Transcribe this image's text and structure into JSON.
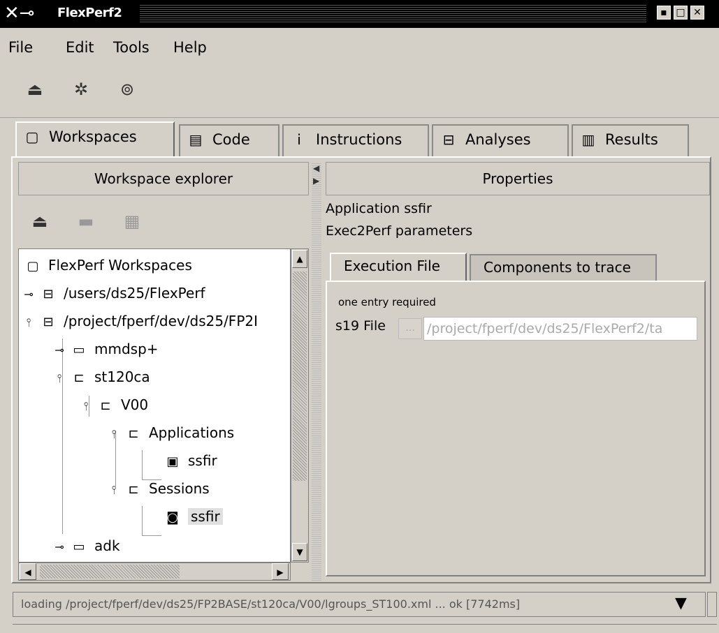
{
  "window": {
    "title": "FlexPerf2",
    "icon": "x-window-icon",
    "controls": [
      "▪",
      "▫",
      "x"
    ]
  },
  "menu": [
    "File",
    "Edit",
    "Tools",
    "Help"
  ],
  "toolbar": {
    "icons": [
      "open-workspace-icon",
      "settings-gear-icon",
      "help-icon"
    ]
  },
  "tabs": [
    {
      "label": "Workspaces",
      "icon": "workspace-icon",
      "active": true
    },
    {
      "label": "Code",
      "icon": "code-icon",
      "active": false
    },
    {
      "label": "Instructions",
      "icon": "info-icon",
      "active": false
    },
    {
      "label": "Analyses",
      "icon": "analyses-icon",
      "active": false
    },
    {
      "label": "Results",
      "icon": "results-chart-icon",
      "active": false
    }
  ],
  "left_pane": {
    "header": "Workspace explorer",
    "tree": [
      {
        "label": "FlexPerf Workspaces",
        "icon": "workspace-icon",
        "level": 0
      },
      {
        "label": "/users/ds25/FlexPerf",
        "icon": "drive-icon",
        "level": 0,
        "handle": "collapsed"
      },
      {
        "label": "/project/fperf/dev/ds25/FP2I",
        "icon": "drive-icon",
        "level": 0,
        "handle": "expanded"
      },
      {
        "label": "mmdsp+",
        "icon": "folder-icon",
        "level": 1,
        "handle": "collapsed"
      },
      {
        "label": "st120ca",
        "icon": "folder-open-icon",
        "level": 1,
        "handle": "expanded"
      },
      {
        "label": "V00",
        "icon": "folder-open-icon",
        "level": 2,
        "handle": "expanded"
      },
      {
        "label": "Applications",
        "icon": "folder-open-icon",
        "level": 3,
        "handle": "expanded"
      },
      {
        "label": "ssfir",
        "icon": "application-icon",
        "level": 4
      },
      {
        "label": "Sessions",
        "icon": "folder-open-icon",
        "level": 3,
        "handle": "expanded"
      },
      {
        "label": "ssfir",
        "icon": "session-icon",
        "level": 4,
        "selected": true
      },
      {
        "label": "adk",
        "icon": "folder-icon",
        "level": 1,
        "handle": "collapsed"
      }
    ]
  },
  "right_pane": {
    "header": "Properties",
    "line1": "Application  ssfir",
    "line2": "Exec2Perf parameters",
    "subtabs": [
      "Execution File",
      "Components to trace"
    ],
    "required_note": "one entry required",
    "file_label": "s19 File",
    "browse_label": "...",
    "file_path": "/project/fperf/dev/ds25/FlexPerf2/ta"
  },
  "status": {
    "text": "loading /project/fperf/dev/ds25/FP2BASE/st120ca/V00/lgroups_ST100.xml ... ok [7742ms]"
  }
}
